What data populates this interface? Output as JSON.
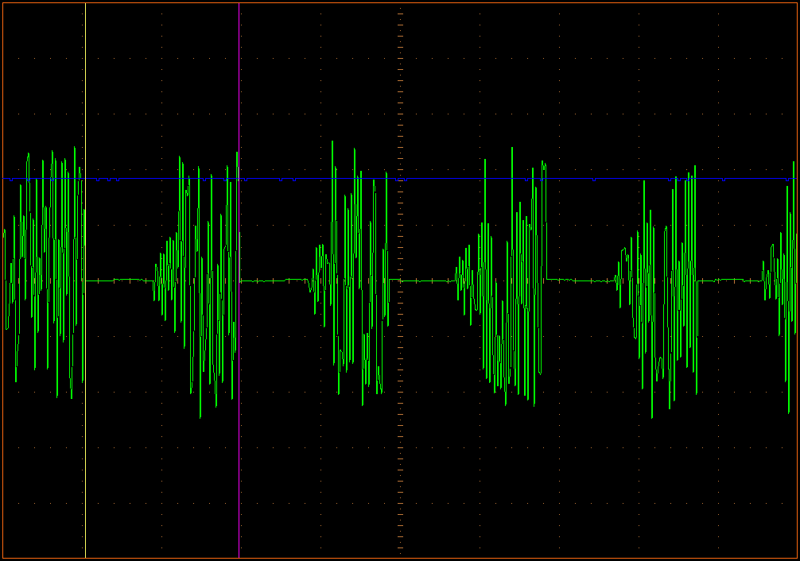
{
  "scope": {
    "traces": [
      {
        "kind": "burst",
        "color": "#00ff00"
      },
      {
        "kind": "level",
        "color": "#0000ff"
      }
    ],
    "cursors": [
      {
        "color": "#ffff60"
      },
      {
        "color": "#ff00ff"
      }
    ]
  }
}
